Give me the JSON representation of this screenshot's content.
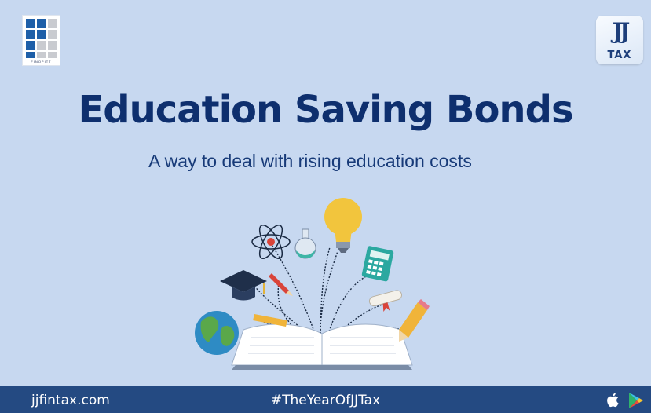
{
  "headline": {
    "title": "Education Saving Bonds",
    "subtitle": "A way to deal with rising education costs"
  },
  "footer": {
    "website": "jjfintax.com",
    "hashtag": "#TheYearOfJJTax"
  },
  "brand": {
    "right_logo_top": "JJ",
    "right_logo_bottom": "TAX",
    "left_logo_caption": "FINOPITT"
  },
  "icons": {
    "left_logo": "grid-logo-icon",
    "right_logo": "jjtax-logo-icon",
    "apple_store": "apple-icon",
    "play_store": "google-play-icon"
  },
  "colors": {
    "background": "#c7d8f0",
    "title": "#0e2f6e",
    "footer_bar": "#244a82"
  }
}
